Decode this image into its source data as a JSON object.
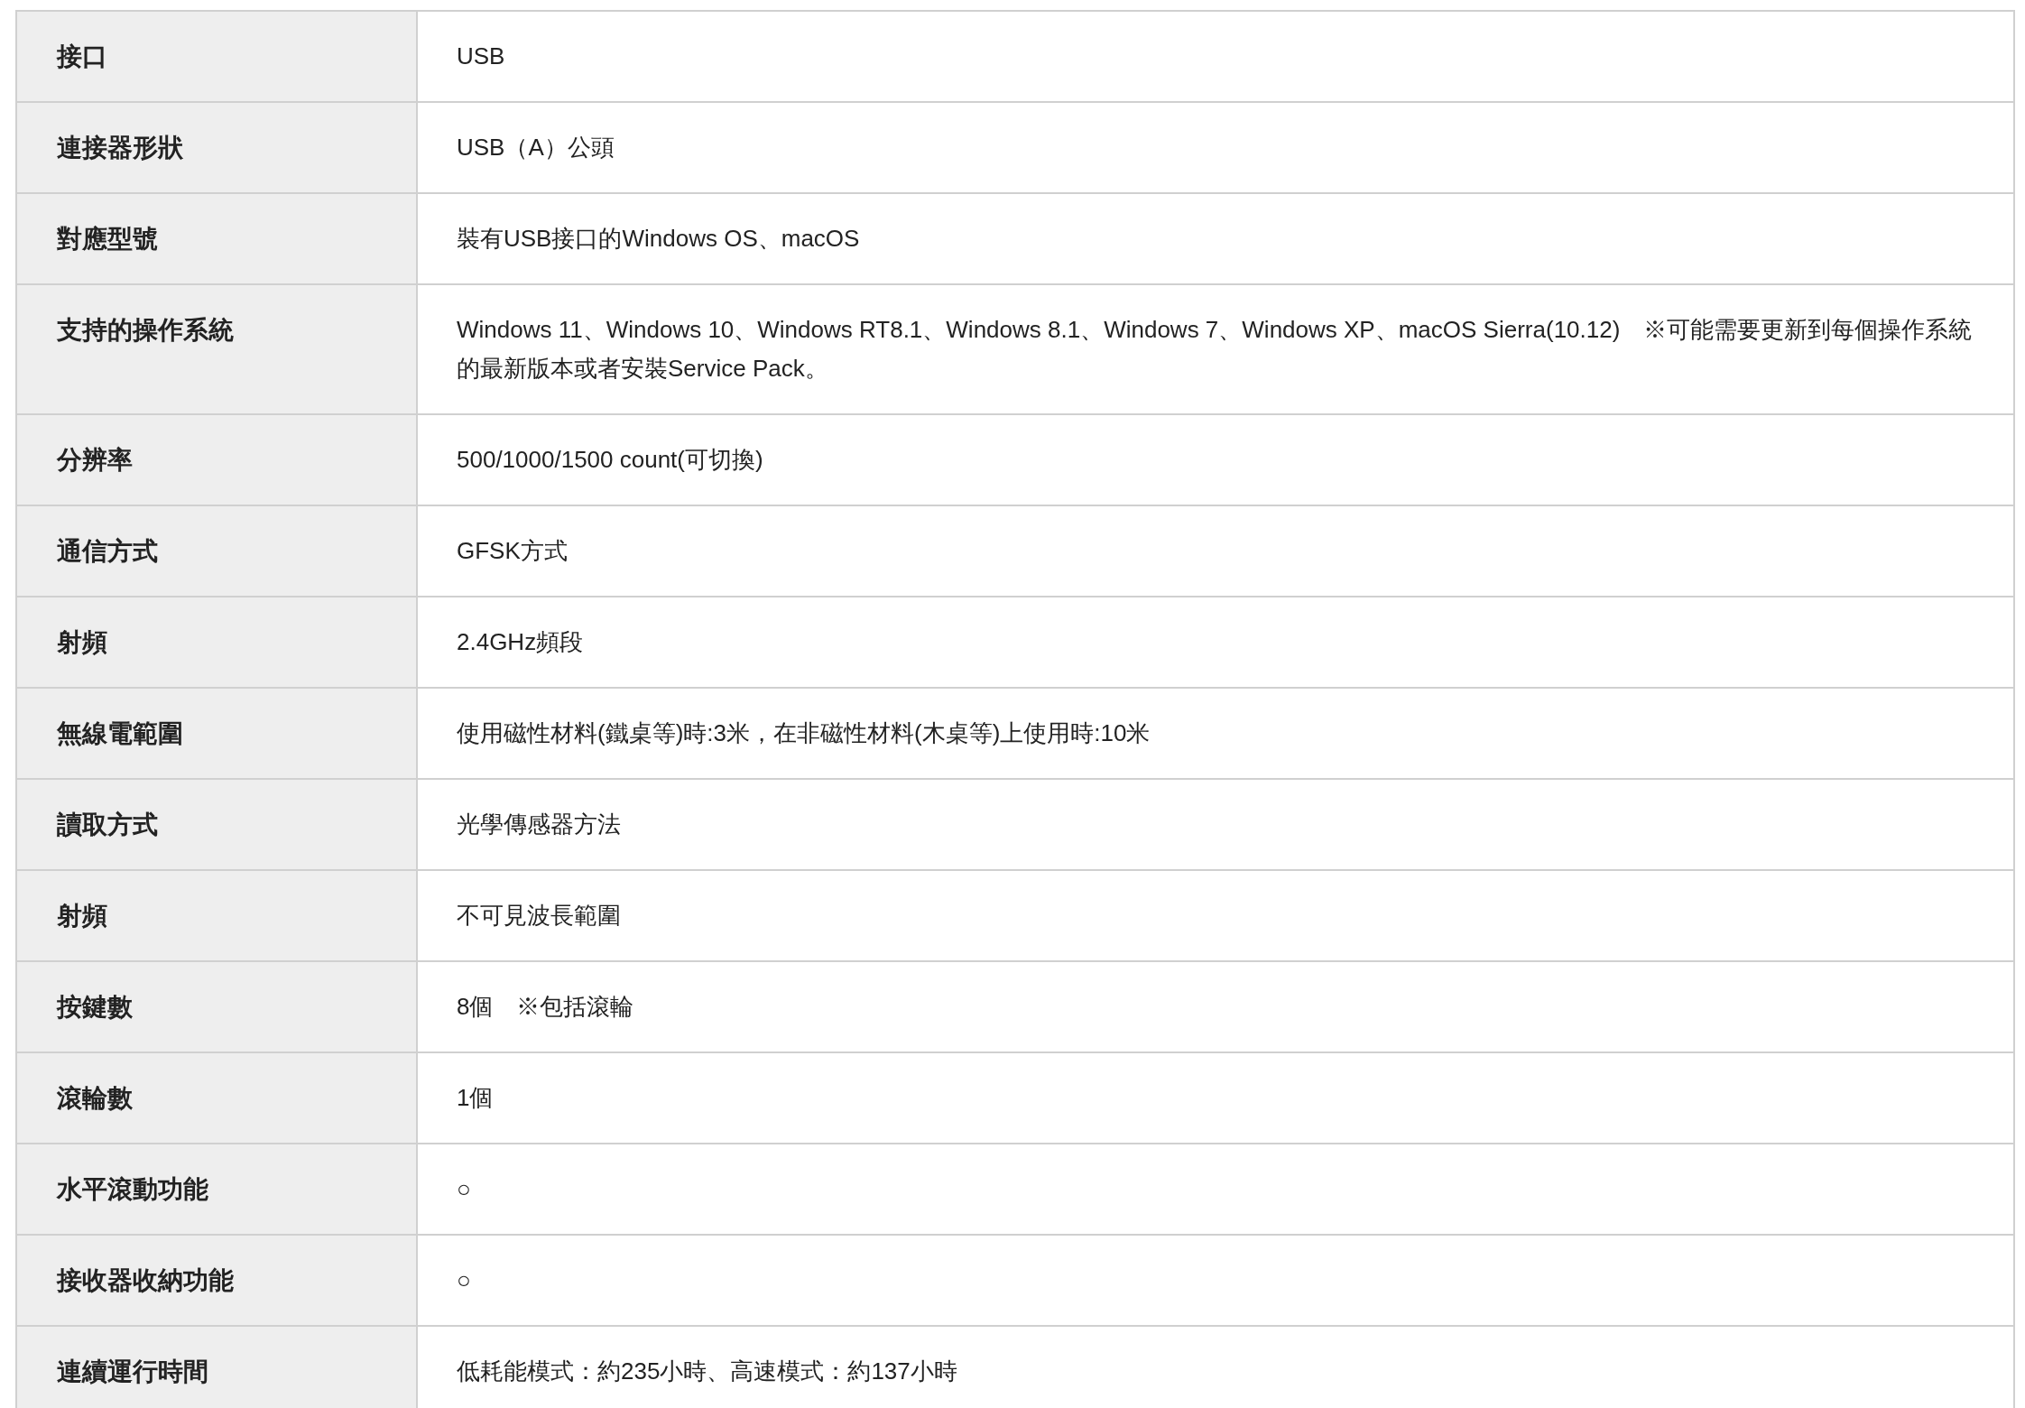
{
  "spec_table": {
    "rows": [
      {
        "label": "接口",
        "value": "USB"
      },
      {
        "label": "連接器形狀",
        "value": "USB（A）公頭"
      },
      {
        "label": "對應型號",
        "value": "裝有USB接口的Windows OS、macOS"
      },
      {
        "label": "支持的操作系統",
        "value": "Windows 11、Windows 10、Windows RT8.1、Windows 8.1、Windows 7、Windows XP、macOS Sierra(10.12)　※可能需要更新到每個操作系統的最新版本或者安裝Service Pack。"
      },
      {
        "label": "分辨率",
        "value": "500/1000/1500 count(可切換)"
      },
      {
        "label": "通信方式",
        "value": "GFSK方式"
      },
      {
        "label": "射頻",
        "value": "2.4GHz頻段"
      },
      {
        "label": "無線電範圍",
        "value": "使用磁性材料(鐵桌等)時:3米，在非磁性材料(木桌等)上使用時:10米"
      },
      {
        "label": "讀取方式",
        "value": "光學傳感器方法"
      },
      {
        "label": "射頻",
        "value": "不可見波長範圍"
      },
      {
        "label": "按鍵數",
        "value": "8個　※包括滾輪"
      },
      {
        "label": "滾輪數",
        "value": "1個"
      },
      {
        "label": "水平滾動功能",
        "value": "○"
      },
      {
        "label": "接收器收納功能",
        "value": "○"
      },
      {
        "label": "連續運行時間",
        "value": "低耗能模式：約235小時、高速模式：約137小時"
      }
    ]
  }
}
